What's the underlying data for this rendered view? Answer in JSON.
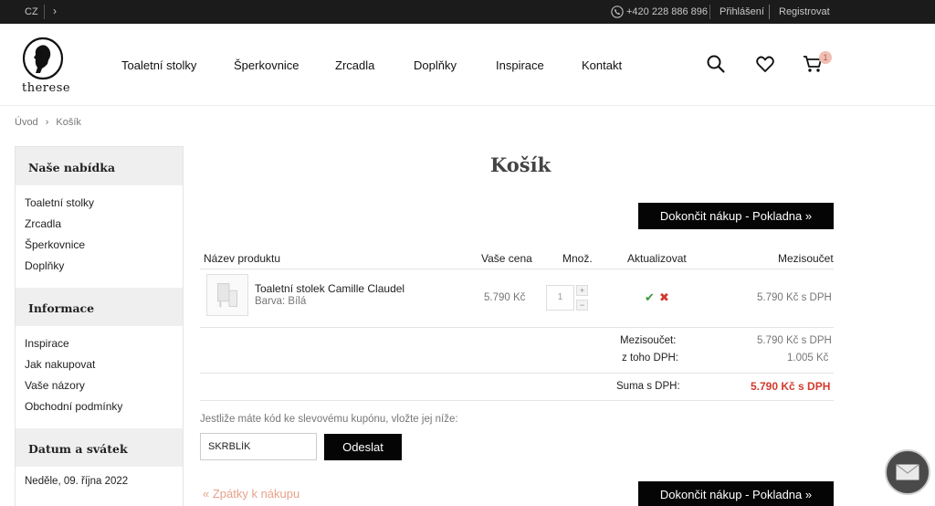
{
  "topbar": {
    "lang": "CZ",
    "phone": "+420 228 886 896",
    "login": "Přihlášení",
    "register": "Registrovat"
  },
  "header": {
    "logo_text": "therese",
    "nav": [
      "Toaletní stolky",
      "Šperkovnice",
      "Zrcadla",
      "Doplňky",
      "Inspirace",
      "Kontakt"
    ],
    "cart_count": "1"
  },
  "breadcrumb": {
    "home": "Úvod",
    "current": "Košík"
  },
  "sidebar": {
    "offer_title": "Naše nabídka",
    "offer_items": [
      "Toaletní stolky",
      "Zrcadla",
      "Šperkovnice",
      "Doplňky"
    ],
    "info_title": "Informace",
    "info_items": [
      "Inspirace",
      "Jak nakupovat",
      "Vaše názory",
      "Obchodní podmínky"
    ],
    "date_title": "Datum a svátek",
    "date_value": "Neděle, 09. října 2022"
  },
  "cart": {
    "title": "Košík",
    "checkout_label": "Dokončit nákup - Pokladna »",
    "columns": {
      "name": "Název produktu",
      "price": "Vaše cena",
      "qty": "Množ.",
      "update": "Aktualizovat",
      "subtotal": "Mezisoučet"
    },
    "items": [
      {
        "name": "Toaletní stolek Camille Claudel",
        "variant": "Barva: Bílá",
        "price": "5.790 Kč",
        "qty": "1",
        "subtotal": "5.790 Kč s DPH"
      }
    ],
    "summary": {
      "subtotal_label": "Mezisoučet:",
      "subtotal_value": "5.790 Kč s DPH",
      "vat_label": "z toho DPH:",
      "vat_value": "1.005 Kč",
      "total_label": "Suma s DPH:",
      "total_value": "5.790 Kč s DPH"
    },
    "coupon_text": "Jestliže máte kód ke slevovému kupónu, vložte jej níže:",
    "coupon_value": "SKRBLÍK",
    "coupon_button": "Odeslat",
    "back_link": "« Zpátky k nákupu"
  },
  "colors": {
    "accent": "#d23a2e",
    "link": "#e7a28a",
    "dark": "#050505"
  }
}
